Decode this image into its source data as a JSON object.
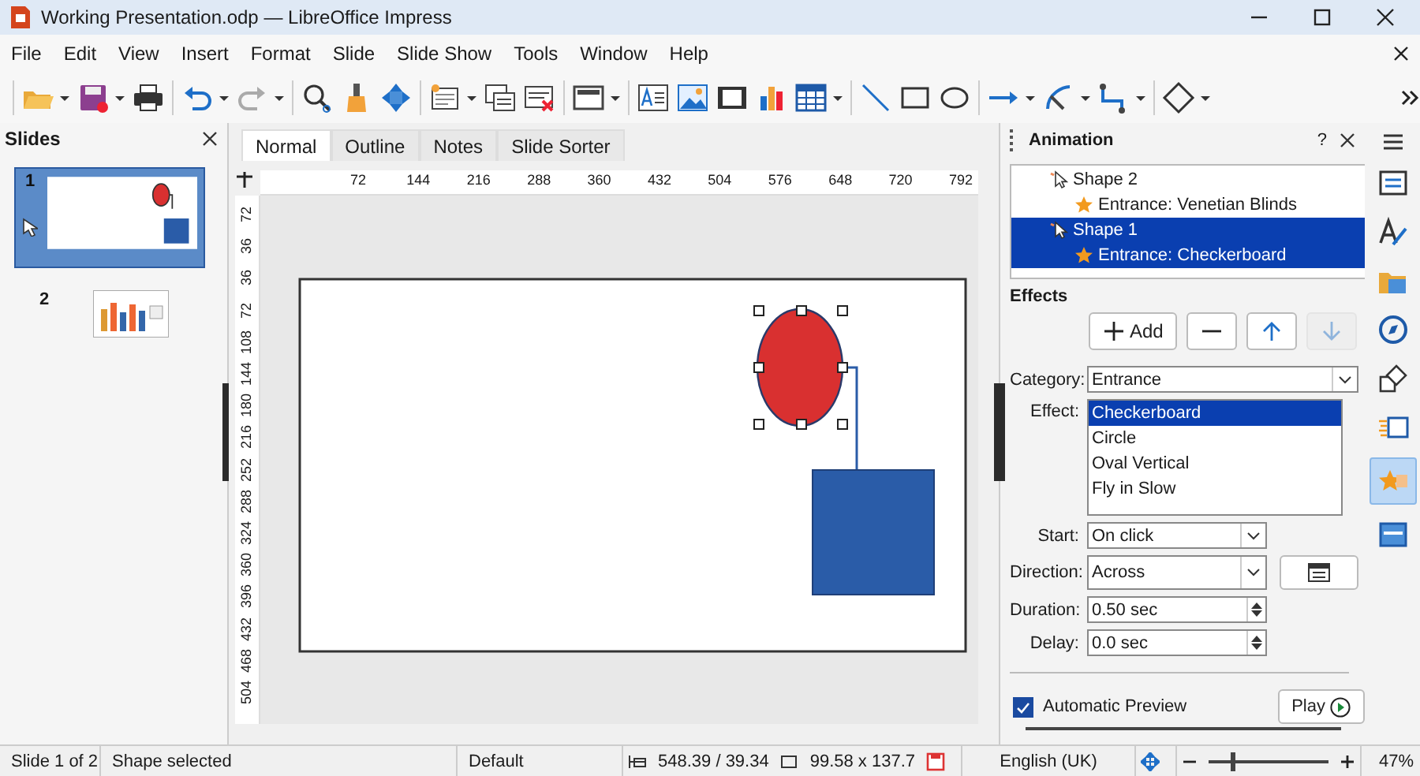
{
  "window": {
    "title": "Working Presentation.odp — LibreOffice Impress"
  },
  "menu": [
    "File",
    "Edit",
    "View",
    "Insert",
    "Format",
    "Slide",
    "Slide Show",
    "Tools",
    "Window",
    "Help"
  ],
  "slides_pane": {
    "title": "Slides",
    "slides": [
      {
        "number": "1",
        "selected": true
      },
      {
        "number": "2",
        "selected": false
      }
    ]
  },
  "view_tabs": [
    {
      "label": "Normal",
      "selected": true
    },
    {
      "label": "Outline",
      "selected": false
    },
    {
      "label": "Notes",
      "selected": false
    },
    {
      "label": "Slide Sorter",
      "selected": false
    }
  ],
  "ruler": {
    "horizontal": [
      "72",
      "144",
      "216",
      "288",
      "360",
      "432",
      "504",
      "576",
      "648",
      "720",
      "792"
    ],
    "vertical": [
      "72",
      "36",
      "36",
      "72",
      "108",
      "144",
      "180",
      "216",
      "252",
      "288",
      "324",
      "360",
      "396",
      "432",
      "468",
      "504"
    ]
  },
  "animation": {
    "title": "Animation",
    "help": "?",
    "list": [
      {
        "label": "Shape 2",
        "selected": false,
        "children": [
          {
            "label": "Entrance: Venetian Blinds",
            "selected": false
          }
        ]
      },
      {
        "label": "Shape 1",
        "selected": true,
        "children": [
          {
            "label": "Entrance: Checkerboard",
            "selected": true
          }
        ]
      }
    ],
    "effects_title": "Effects",
    "buttons": [
      {
        "kind": "add",
        "label": "Add",
        "disabled": false
      },
      {
        "kind": "remove",
        "disabled": false
      },
      {
        "kind": "up",
        "disabled": false
      },
      {
        "kind": "down",
        "disabled": true
      }
    ],
    "category": {
      "label": "Category:",
      "value": "Entrance"
    },
    "effect": {
      "label": "Effect:",
      "options": [
        {
          "label": "Checkerboard",
          "selected": true
        },
        {
          "label": "Circle",
          "selected": false
        },
        {
          "label": "Oval Vertical",
          "selected": false
        },
        {
          "label": "Fly in Slow",
          "selected": false
        }
      ]
    },
    "start": {
      "label": "Start:",
      "value": "On click"
    },
    "direction": {
      "label": "Direction:",
      "value": "Across"
    },
    "duration": {
      "label": "Duration:",
      "value": "0.50 sec"
    },
    "delay": {
      "label": "Delay:",
      "value": "0.0 sec"
    },
    "automatic_preview": {
      "label": "Automatic Preview",
      "checked": true
    },
    "play": {
      "label": "Play"
    }
  },
  "deck_tabs": [
    {
      "kind": "properties",
      "selected": false
    },
    {
      "kind": "styles",
      "selected": false
    },
    {
      "kind": "gallery",
      "selected": false
    },
    {
      "kind": "navigator",
      "selected": false
    },
    {
      "kind": "shapes",
      "selected": false
    },
    {
      "kind": "transition",
      "selected": false
    },
    {
      "kind": "animation",
      "selected": true
    },
    {
      "kind": "master",
      "selected": false
    }
  ],
  "status_bar": {
    "slide": "Slide 1 of 2",
    "selection": "Shape selected",
    "master": "Default",
    "position": "548.39 / 39.34",
    "size": "99.58 x 137.7",
    "language": "English (UK)",
    "zoom_slider": {
      "level": 0.2
    },
    "zoom": "47%"
  }
}
